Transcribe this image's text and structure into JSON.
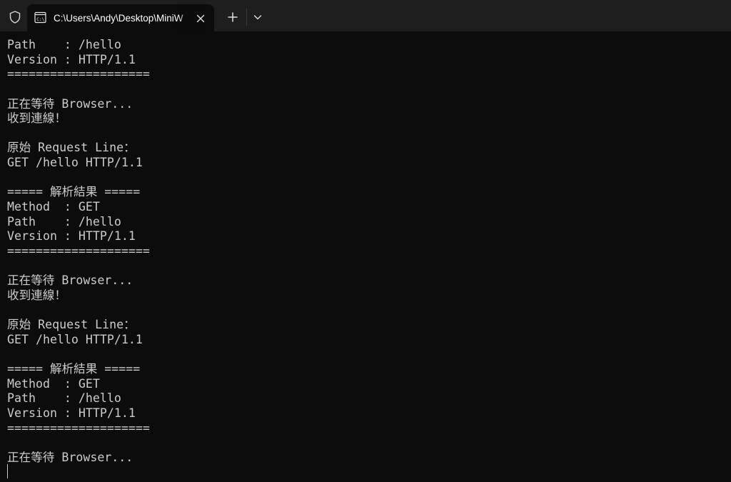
{
  "tab": {
    "title": "C:\\Users\\Andy\\Desktop\\MiniW",
    "icon": "console-icon"
  },
  "icons": {
    "shield": "shield-icon",
    "close": "close-icon",
    "new_tab": "plus-icon",
    "dropdown": "chevron-down-icon"
  },
  "colors": {
    "titlebar": "#1e1e1e",
    "terminal_bg": "#0c0c0c",
    "terminal_text": "#cccccc"
  },
  "terminal": {
    "lines": [
      "Path    : /hello",
      "Version : HTTP/1.1",
      "====================",
      "",
      "正在等待 Browser...",
      "收到連線！",
      "",
      "原始 Request Line：",
      "GET /hello HTTP/1.1",
      "",
      "===== 解析結果 =====",
      "Method  : GET",
      "Path    : /hello",
      "Version : HTTP/1.1",
      "====================",
      "",
      "正在等待 Browser...",
      "收到連線！",
      "",
      "原始 Request Line：",
      "GET /hello HTTP/1.1",
      "",
      "===== 解析結果 =====",
      "Method  : GET",
      "Path    : /hello",
      "Version : HTTP/1.1",
      "====================",
      "",
      "正在等待 Browser..."
    ]
  }
}
